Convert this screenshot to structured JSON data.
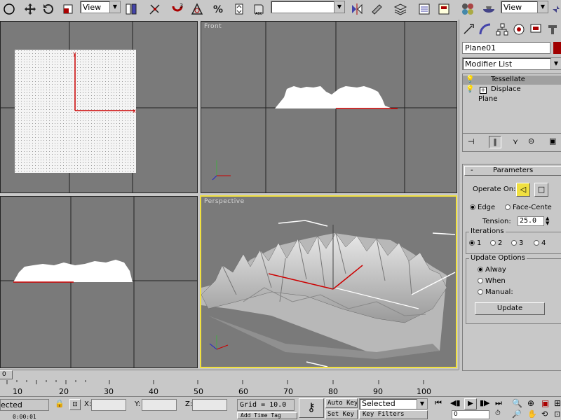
{
  "toolbar": {
    "view_dropdown_1": "View",
    "view_dropdown_2": "View"
  },
  "viewports": {
    "top_label": "",
    "front_label": "Front",
    "left_label": "",
    "perspective_label": "Perspective"
  },
  "command_panel": {
    "object_name": "Plane01",
    "modifier_list": "Modifier List",
    "stack": [
      "Tessellate",
      "Displace",
      "Plane"
    ],
    "parameters_title": "Parameters",
    "operate_on_label": "Operate On:",
    "edge_label": "Edge",
    "face_center_label": "Face-Cente",
    "tension_label": "Tension:",
    "tension_value": "25.0",
    "iterations_label": "Iterations",
    "iterations": [
      "1",
      "2",
      "3",
      "4"
    ],
    "update_options_label": "Update Options",
    "always_label": "Alway",
    "when_label": "When",
    "manual_label": "Manual:",
    "update_button": "Update"
  },
  "timeline": {
    "slider_label": "0",
    "ticks": [
      "10",
      "20",
      "30",
      "40",
      "50",
      "60",
      "70",
      "80",
      "90",
      "100"
    ]
  },
  "status": {
    "selection_text": "ected",
    "x_label": "X:",
    "y_label": "Y:",
    "z_label": "Z:",
    "grid_text": "Grid = 10.0",
    "auto_key": "Auto Key",
    "selected_dropdown": "Selected",
    "set_key": "Set Key",
    "key_filters": "Key Filters",
    "add_time_tag": "Add Time Tag",
    "time_text": "0:00:01",
    "frame_value": "0"
  },
  "colors": {
    "viewport_bg": "#7a7a7a",
    "active_border": "#f0e040",
    "ui_bg": "#c8c8c8",
    "selected_stack": "#a0a0a0",
    "object_color": "#a00000"
  }
}
